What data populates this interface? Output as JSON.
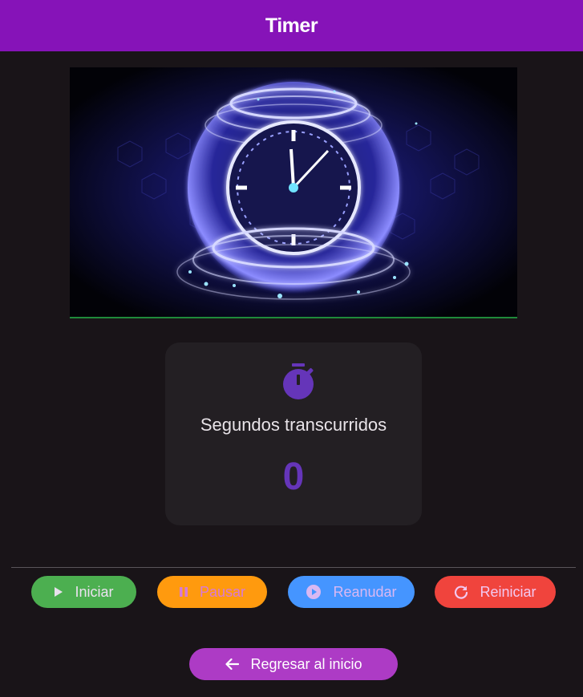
{
  "appbar": {
    "title": "Timer"
  },
  "hero": {
    "alt": "Glowing holographic clock"
  },
  "card": {
    "icon": "stopwatch-icon",
    "label": "Segundos transcurridos",
    "value": "0"
  },
  "controls": {
    "start_label": "Iniciar",
    "pause_label": "Pausar",
    "resume_label": "Reanudar",
    "reset_label": "Reiniciar"
  },
  "back_button": {
    "label": "Regresar al inicio"
  },
  "colors": {
    "appbar": "#8613b8",
    "background": "#191418",
    "accent": "#6535b9",
    "start": "#4caf50",
    "pause": "#ff9a0e",
    "resume": "#4595ff",
    "reset": "#f0443d",
    "back": "#ad3bc5"
  }
}
